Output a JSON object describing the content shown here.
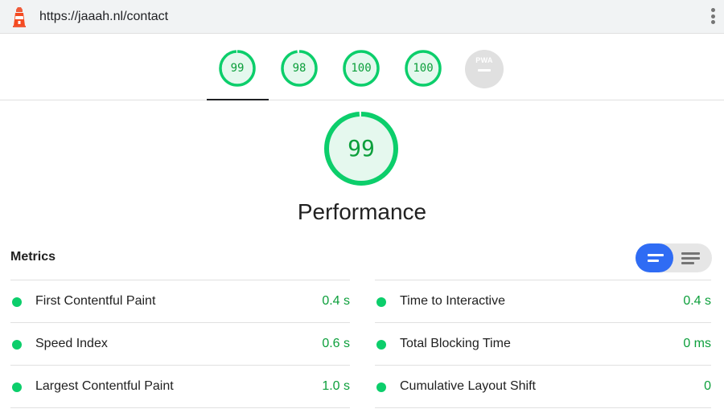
{
  "topbar": {
    "url": "https://jaaah.nl/contact",
    "logo_icon": "lighthouse-icon",
    "menu_icon": "kebab-menu-icon"
  },
  "gauges": [
    {
      "score": "99",
      "fraction": 0.99,
      "name": "gauge-performance"
    },
    {
      "score": "98",
      "fraction": 0.98,
      "name": "gauge-accessibility"
    },
    {
      "score": "100",
      "fraction": 1.0,
      "name": "gauge-best-practices"
    },
    {
      "score": "100",
      "fraction": 1.0,
      "name": "gauge-seo"
    }
  ],
  "pwa": {
    "label": "PWA",
    "icon": "pwa-badge-icon"
  },
  "category": {
    "score": "99",
    "fraction": 0.99,
    "title": "Performance"
  },
  "metrics": {
    "header": "Metrics",
    "view_toggle_icons": [
      "compact-view-icon",
      "expanded-view-icon"
    ],
    "left": [
      {
        "name": "First Contentful Paint",
        "value": "0.4 s"
      },
      {
        "name": "Speed Index",
        "value": "0.6 s"
      },
      {
        "name": "Largest Contentful Paint",
        "value": "1.0 s"
      }
    ],
    "right": [
      {
        "name": "Time to Interactive",
        "value": "0.4 s"
      },
      {
        "name": "Total Blocking Time",
        "value": "0 ms"
      },
      {
        "name": "Cumulative Layout Shift",
        "value": "0"
      }
    ]
  },
  "colors": {
    "pass": "#0cce6b",
    "pass_text": "#0c9f3b",
    "pass_fill": "#e5f8ee",
    "accent": "#2f6cf4"
  }
}
